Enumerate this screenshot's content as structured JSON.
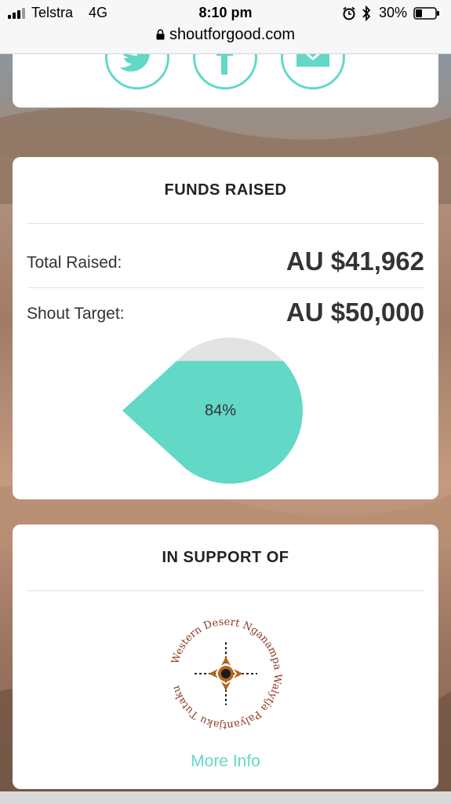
{
  "status_bar": {
    "carrier": "Telstra",
    "network": "4G",
    "time": "8:10 pm",
    "battery_percent": "30%",
    "url": "shoutforgood.com"
  },
  "share": {
    "icons": [
      "twitter-icon",
      "facebook-icon",
      "email-icon"
    ],
    "accent_color": "#62d8c6"
  },
  "funds": {
    "title": "FUNDS RAISED",
    "total_label": "Total Raised:",
    "total_value": "AU $41,962",
    "target_label": "Shout Target:",
    "target_value": "AU $50,000",
    "progress_label": "84%",
    "progress_fraction": 0.84
  },
  "support": {
    "title": "IN SUPPORT OF",
    "logo_text": "Western Desert Nganampa Walytja Palyantjaku Tutaku",
    "more_info": "More Info"
  }
}
